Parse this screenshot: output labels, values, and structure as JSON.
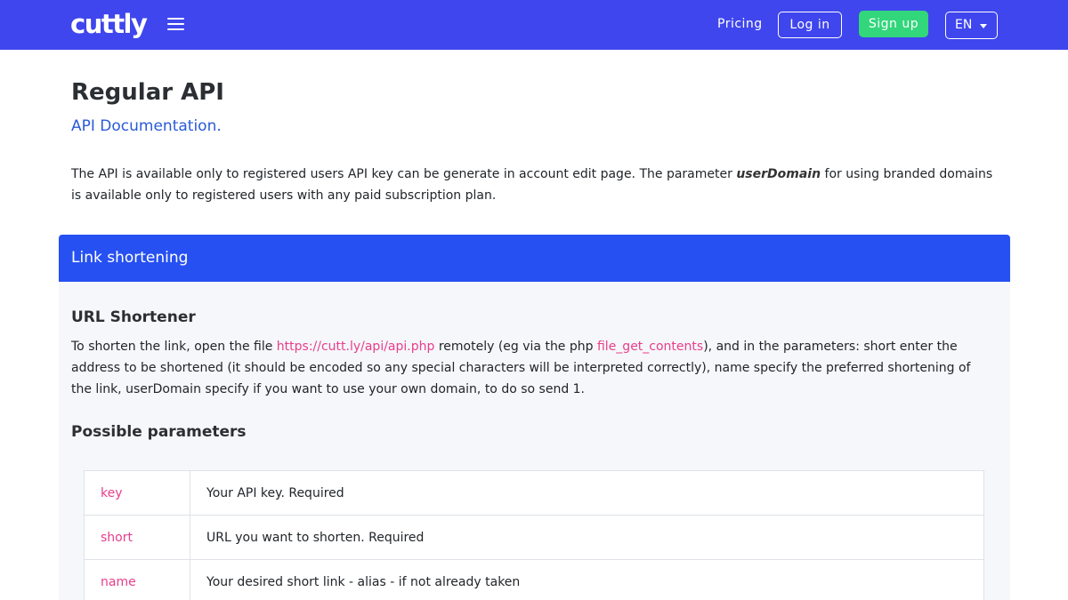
{
  "navbar": {
    "logo": "cuttly",
    "pricing": "Pricing",
    "login": "Log in",
    "signup": "Sign up",
    "language": "EN"
  },
  "page": {
    "title": "Regular API",
    "subtitle": "API Documentation.",
    "intro_before": "The API is available only to registered users API key can be generate in account edit page. The parameter ",
    "intro_em": "userDomain",
    "intro_after": " for using branded domains is available only to registered users with any paid subscription plan."
  },
  "card": {
    "header": "Link shortening",
    "section_title": "URL Shortener",
    "body_1": "To shorten the link, open the file ",
    "api_link": "https://cutt.ly/api/api.php",
    "body_2": " remotely (eg via the php ",
    "php_link": "file_get_contents",
    "body_3": "), and in the parameters: short enter the address to be shortened (it should be encoded so any special characters will be interpreted correctly), name specify the preferred shortening of the link, userDomain specify if you want to use your own domain, to do so send 1.",
    "params_title": "Possible parameters",
    "params": [
      {
        "name": "key",
        "desc": "Your API key. Required"
      },
      {
        "name": "short",
        "desc": "URL you want to shorten. Required"
      },
      {
        "name": "name",
        "desc": "Your desired short link - alias - if not already taken"
      }
    ]
  },
  "colors": {
    "navbar": "#3f46ed",
    "card_header": "#2650f1",
    "signup": "#32d67b",
    "link": "#e83e8c",
    "subtitle": "#2a5bd7"
  }
}
